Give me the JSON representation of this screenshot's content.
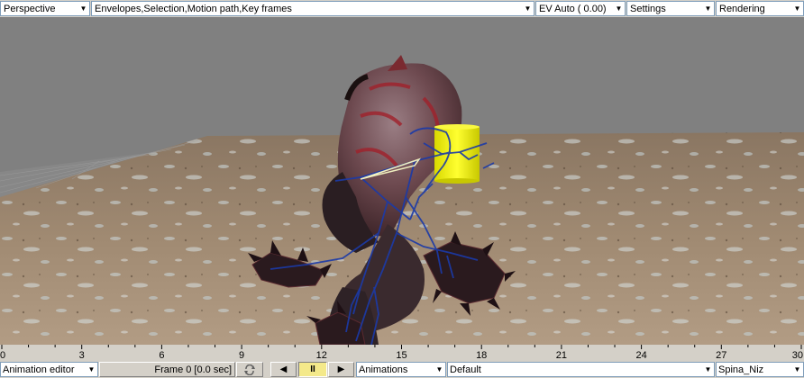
{
  "toolbar": {
    "view_mode": "Perspective",
    "display_options": "Envelopes,Selection,Motion path,Key frames",
    "exposure": "EV Auto ( 0.00)",
    "settings": "Settings",
    "rendering": "Rendering"
  },
  "timeline": {
    "ticks": [
      "0",
      "3",
      "6",
      "9",
      "12",
      "15",
      "18",
      "21",
      "24",
      "27",
      "30"
    ]
  },
  "bottombar": {
    "editor": "Animation editor",
    "frame_label": "Frame 0 [0.0 sec]",
    "animations": "Animations",
    "animation_name": "Default",
    "bone": "Spina_Niz"
  },
  "colors": {
    "viewport_bg": "#808080",
    "bone_color": "#1b3aa8",
    "marker_yellow": "#f0f000",
    "active_button": "#f4e98a"
  }
}
